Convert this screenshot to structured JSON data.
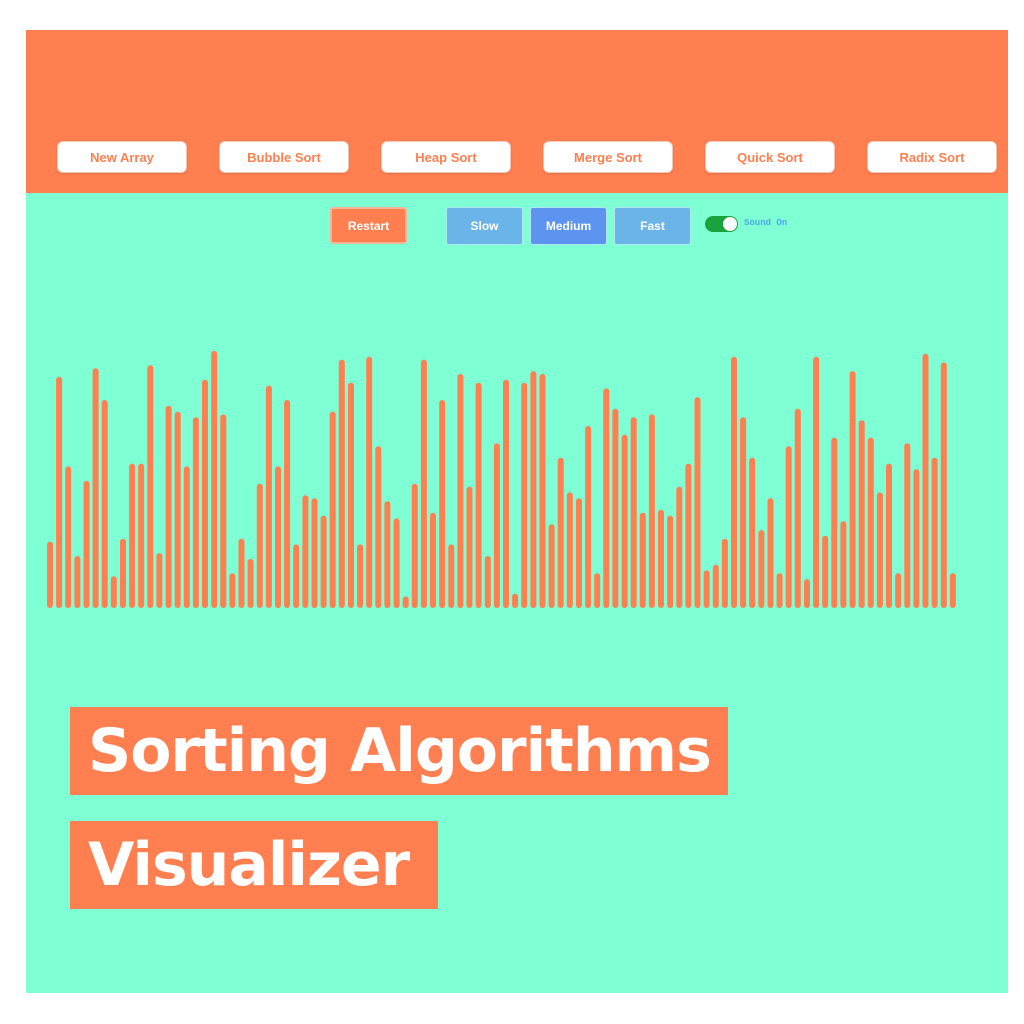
{
  "toolbar": {
    "algorithms": [
      "New Array",
      "Bubble Sort",
      "Heap Sort",
      "Merge Sort",
      "Quick Sort",
      "Radix Sort"
    ]
  },
  "controls": {
    "restart_label": "Restart",
    "speeds": [
      "Slow",
      "Medium",
      "Fast"
    ],
    "selected_speed": "Medium",
    "sound_label": "Sound On",
    "sound_on": true
  },
  "array": {
    "values": [
      23,
      80,
      49,
      18,
      44,
      83,
      72,
      11,
      24,
      50,
      50,
      84,
      19,
      70,
      68,
      49,
      66,
      79,
      89,
      67,
      12,
      24,
      17,
      43,
      77,
      49,
      72,
      22,
      39,
      38,
      32,
      68,
      86,
      78,
      22,
      87,
      56,
      37,
      31,
      4,
      43,
      86,
      33,
      72,
      22,
      81,
      42,
      78,
      18,
      57,
      79,
      5,
      78,
      82,
      81,
      29,
      52,
      40,
      38,
      63,
      12,
      76,
      69,
      60,
      66,
      33,
      67,
      34,
      32,
      42,
      50,
      73,
      13,
      15,
      24,
      87,
      66,
      52,
      27,
      38,
      12,
      56,
      69,
      10,
      87,
      25,
      59,
      30,
      82,
      65,
      59,
      40,
      50,
      12,
      57,
      48,
      88,
      52,
      85,
      12
    ],
    "max_value": 90,
    "bar_color": "#ff7f50"
  },
  "colors": {
    "accent": "#ff7f50",
    "background": "#7fffd4",
    "speed_default": "#6ab4e8",
    "speed_selected": "#5c94f0",
    "toggle_on": "#1aa33c"
  },
  "title": {
    "line1": "Sorting Algorithms",
    "line2": "Visualizer"
  }
}
